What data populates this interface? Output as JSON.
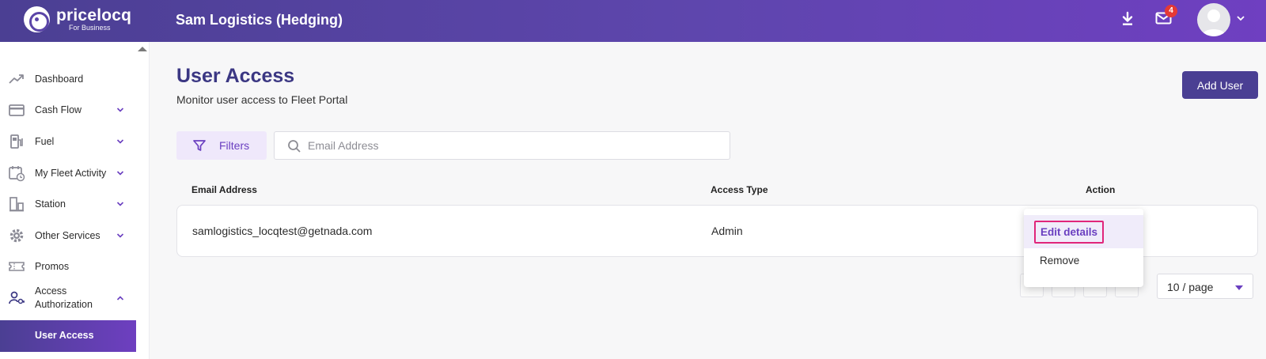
{
  "header": {
    "brand_name": "pricelocq",
    "brand_sub": "For Business",
    "company": "Sam Logistics (Hedging)",
    "notification_count": "4"
  },
  "sidebar": {
    "items": [
      {
        "label": "Dashboard",
        "icon": "trend-up-icon"
      },
      {
        "label": "Cash Flow",
        "icon": "credit-card-icon"
      },
      {
        "label": "Fuel",
        "icon": "fuel-pump-icon"
      },
      {
        "label": "My Fleet Activity",
        "icon": "calendar-clock-icon"
      },
      {
        "label": "Station",
        "icon": "station-icon"
      },
      {
        "label": "Other Services",
        "icon": "gear-icon"
      },
      {
        "label": "Promos",
        "icon": "ticket-icon"
      },
      {
        "label": "Access Authorization",
        "icon": "user-key-icon"
      }
    ],
    "active_subitem": "User Access"
  },
  "page": {
    "title": "User Access",
    "subtitle": "Monitor user access to Fleet Portal",
    "add_user_label": "Add User"
  },
  "filters": {
    "label": "Filters",
    "search_placeholder": "Email Address"
  },
  "table": {
    "columns": [
      "Email Address",
      "Access Type",
      "Action"
    ],
    "rows": [
      {
        "email": "samlogistics_locqtest@getnada.com",
        "access_type": "Admin"
      }
    ]
  },
  "action_menu": {
    "edit_label": "Edit details",
    "remove_label": "Remove"
  },
  "pagination": {
    "page_size": "10 / page"
  },
  "colors": {
    "brand_dark": "#4a3f93",
    "brand_purple": "#6a3fc0",
    "highlight_border": "#e0267a",
    "badge_red": "#e53935"
  }
}
